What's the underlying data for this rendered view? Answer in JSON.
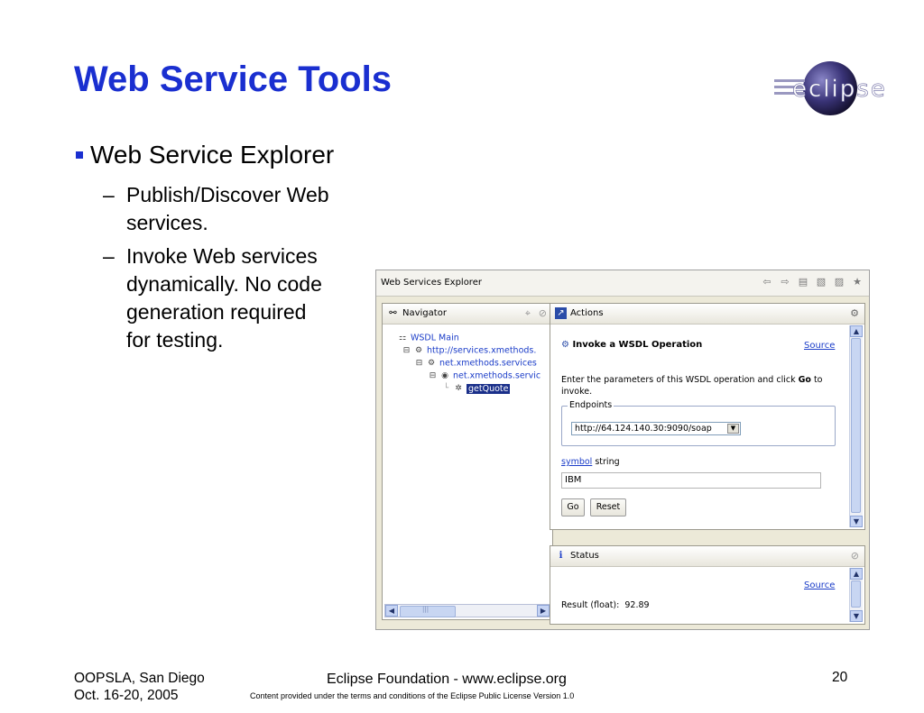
{
  "slide": {
    "title": "Web Service Tools",
    "logo_text": "eclipse",
    "bullet": "Web Service Explorer",
    "sub1_dash": "–",
    "sub1_line1": "Publish/Discover Web",
    "sub1_line2": "services.",
    "sub2_dash": "–",
    "sub2_line1": "Invoke Web services",
    "sub2_line2": "dynamically. No code",
    "sub2_line3": "generation required",
    "sub2_line4": "for testing.",
    "footer_left_line1": "OOPSLA, San Diego",
    "footer_left_line2": "Oct. 16-20, 2005",
    "footer_center": "Eclipse Foundation - www.eclipse.org",
    "footer_license": "Content provided under the terms and conditions of the Eclipse Public License Version 1.0",
    "page_number": "20"
  },
  "explorer": {
    "window_title": "Web Services Explorer",
    "navigator": {
      "title": "Navigator",
      "items": [
        {
          "label": "WSDL Main",
          "icon": "wsdl-main-icon"
        },
        {
          "label": "http://services.xmethods.",
          "icon": "wsdl-service-icon"
        },
        {
          "label": "net.xmethods.services",
          "icon": "service-icon"
        },
        {
          "label": "net.xmethods.servic",
          "icon": "binding-icon"
        },
        {
          "label": "getQuote",
          "icon": "operation-icon"
        }
      ],
      "hscroll_marks": "|||"
    },
    "actions": {
      "title": "Actions",
      "heading": "Invoke a WSDL Operation",
      "source_link": "Source",
      "instruction_pre": "Enter the parameters of this WSDL operation and click ",
      "instruction_bold": "Go",
      "instruction_post": " to invoke.",
      "endpoints_legend": "Endpoints",
      "endpoint_value": "http://64.124.140.30:9090/soap",
      "param_name": "symbol",
      "param_type": "string",
      "param_value": "IBM",
      "go_button": "Go",
      "reset_button": "Reset"
    },
    "status": {
      "title": "Status",
      "source_link": "Source",
      "result": "Result (float):  92.89"
    },
    "colors": {
      "title_blue": "#1a2fd0",
      "selection": "#1a2f8a",
      "link": "#1a3cc8"
    }
  }
}
